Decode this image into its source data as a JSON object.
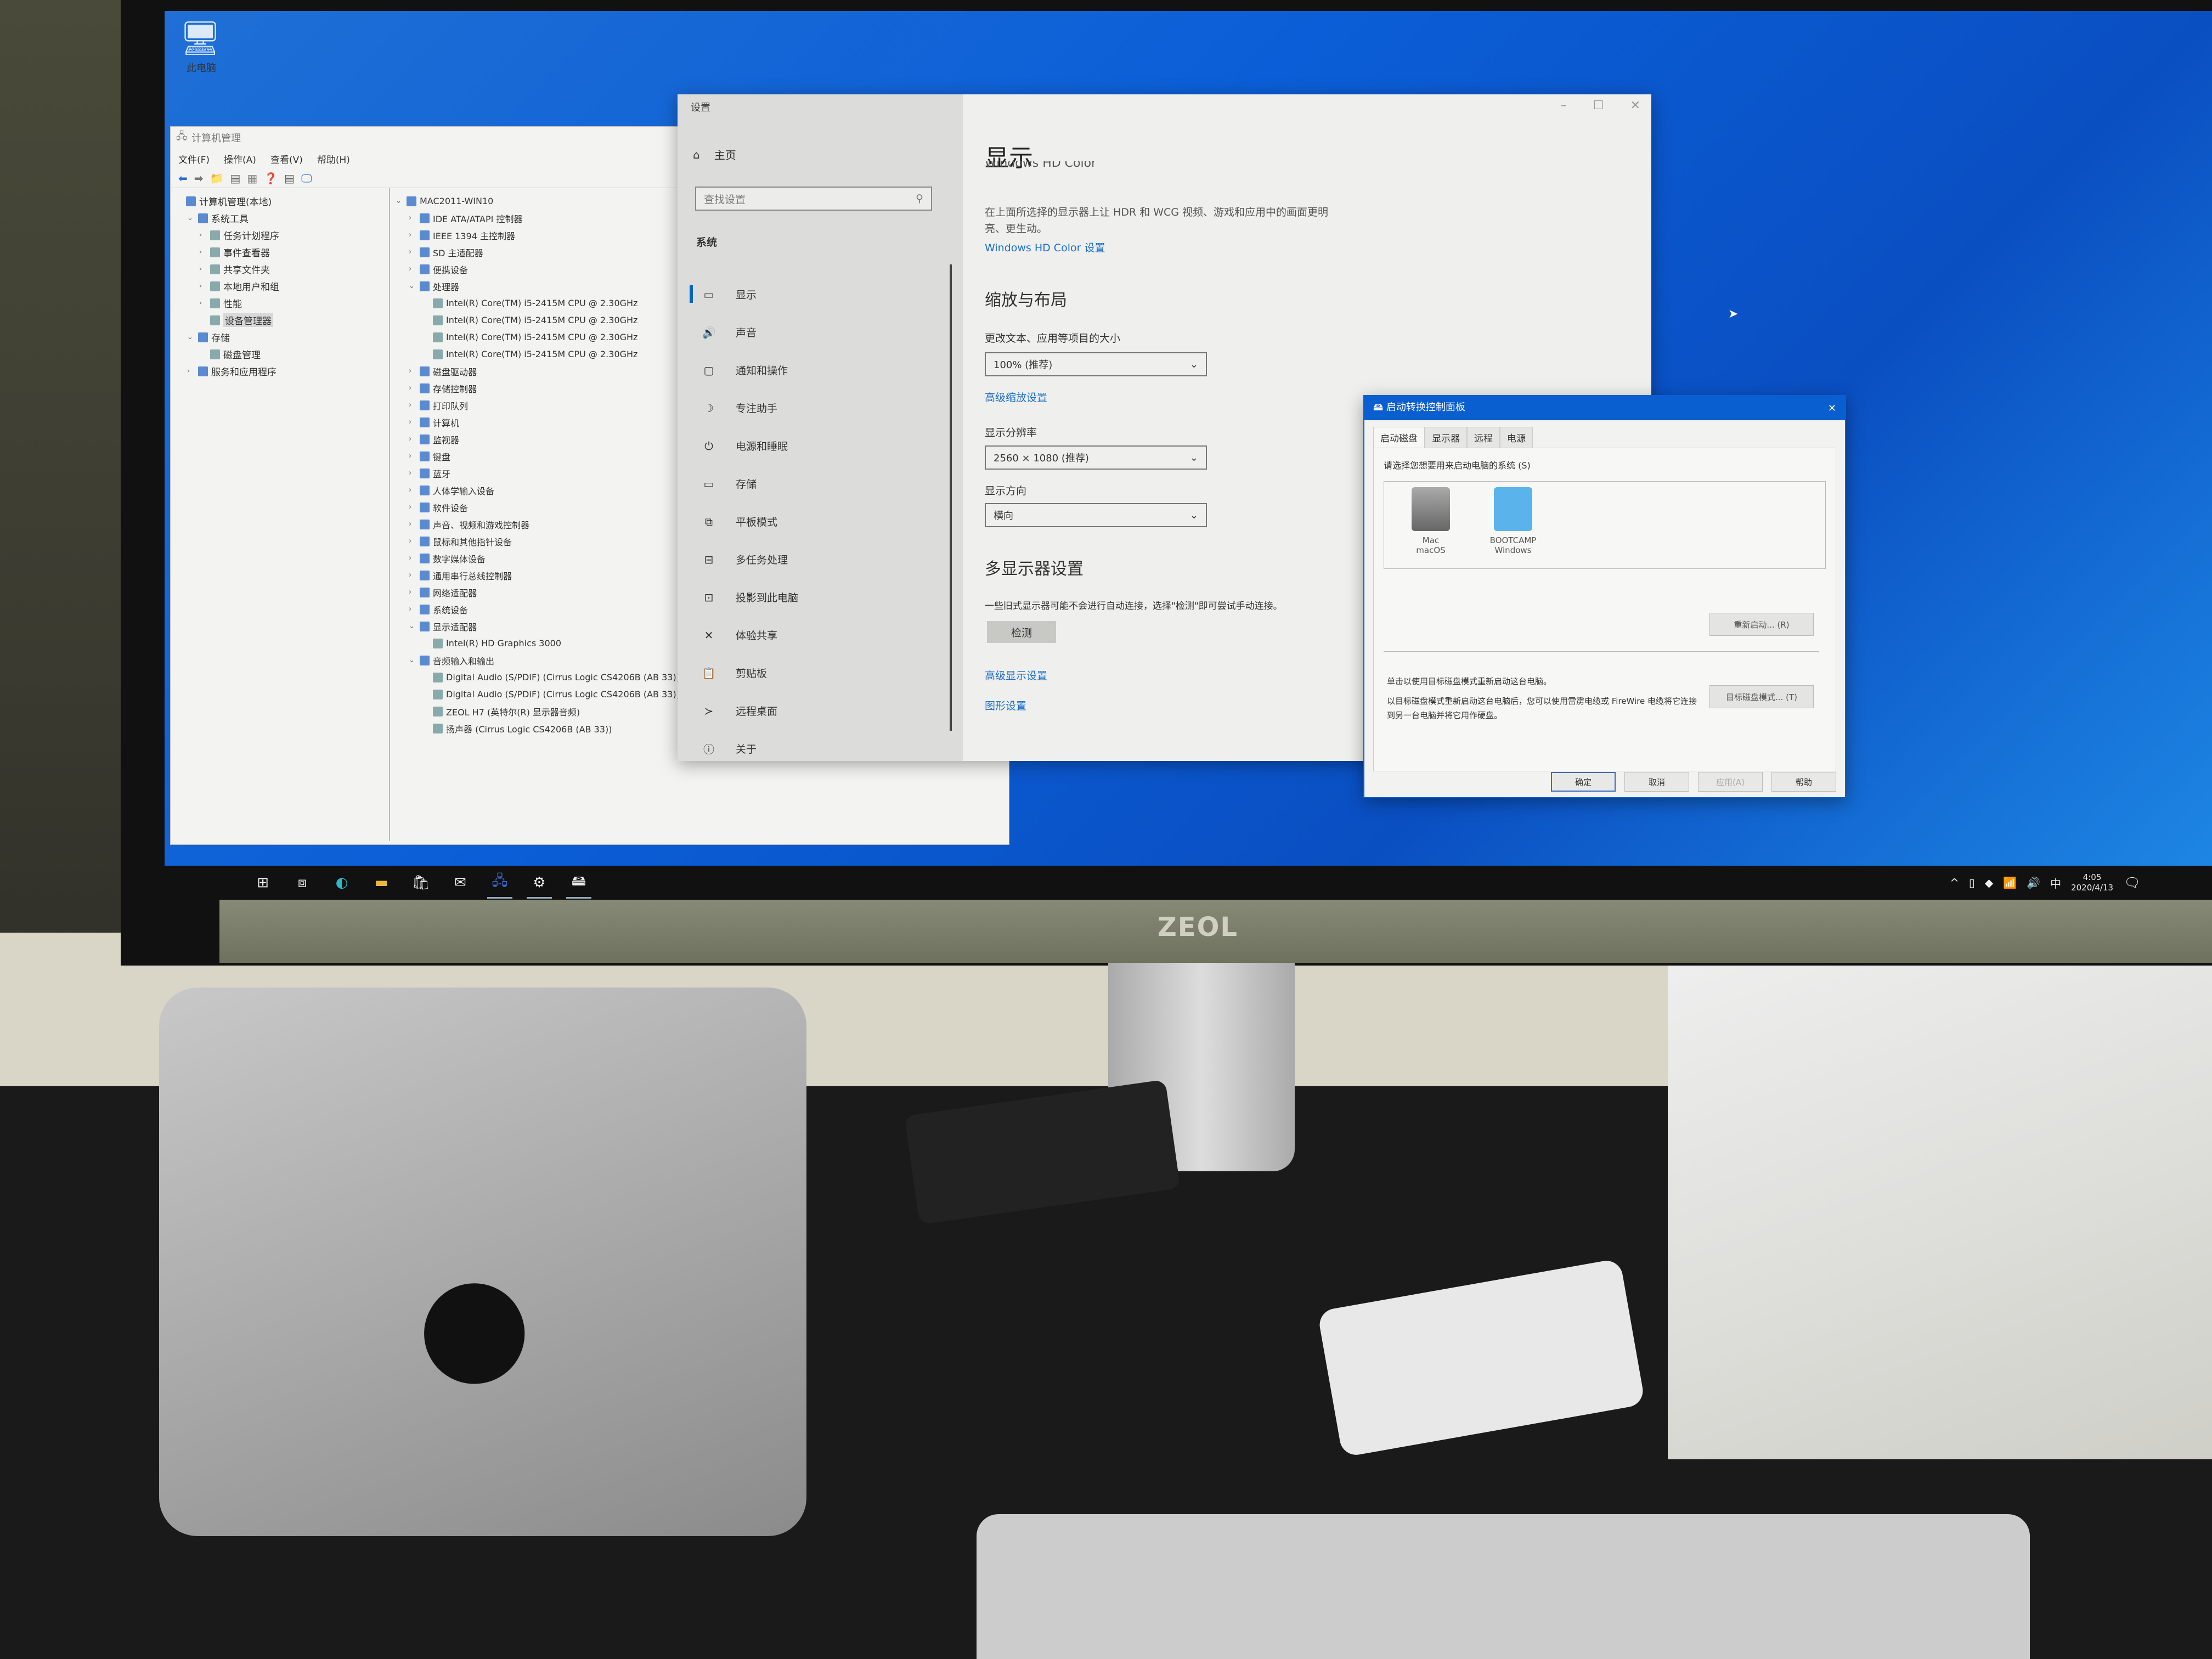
{
  "desktop": {
    "icon_label": "此电脑"
  },
  "computer_management": {
    "title": "计算机管理",
    "menu": [
      "文件(F)",
      "操作(A)",
      "查看(V)",
      "帮助(H)"
    ],
    "left_tree": [
      {
        "label": "计算机管理(本地)",
        "level": 0,
        "expand": ""
      },
      {
        "label": "系统工具",
        "level": 1,
        "expand": "v"
      },
      {
        "label": "任务计划程序",
        "level": 2,
        "expand": ">"
      },
      {
        "label": "事件查看器",
        "level": 2,
        "expand": ">"
      },
      {
        "label": "共享文件夹",
        "level": 2,
        "expand": ">"
      },
      {
        "label": "本地用户和组",
        "level": 2,
        "expand": ">"
      },
      {
        "label": "性能",
        "level": 2,
        "expand": ">"
      },
      {
        "label": "设备管理器",
        "level": 2,
        "expand": "",
        "selected": true
      },
      {
        "label": "存储",
        "level": 1,
        "expand": "v"
      },
      {
        "label": "磁盘管理",
        "level": 2,
        "expand": ""
      },
      {
        "label": "服务和应用程序",
        "level": 1,
        "expand": ">"
      }
    ],
    "device_tree": [
      {
        "label": "MAC2011-WIN10",
        "level": 0,
        "expand": "v"
      },
      {
        "label": "IDE ATA/ATAPI 控制器",
        "level": 1,
        "expand": ">"
      },
      {
        "label": "IEEE 1394 主控制器",
        "level": 1,
        "expand": ">"
      },
      {
        "label": "SD 主适配器",
        "level": 1,
        "expand": ">"
      },
      {
        "label": "便携设备",
        "level": 1,
        "expand": ">"
      },
      {
        "label": "处理器",
        "level": 1,
        "expand": "v"
      },
      {
        "label": "Intel(R) Core(TM) i5-2415M CPU @ 2.30GHz",
        "level": 2,
        "expand": ""
      },
      {
        "label": "Intel(R) Core(TM) i5-2415M CPU @ 2.30GHz",
        "level": 2,
        "expand": ""
      },
      {
        "label": "Intel(R) Core(TM) i5-2415M CPU @ 2.30GHz",
        "level": 2,
        "expand": ""
      },
      {
        "label": "Intel(R) Core(TM) i5-2415M CPU @ 2.30GHz",
        "level": 2,
        "expand": ""
      },
      {
        "label": "磁盘驱动器",
        "level": 1,
        "expand": ">"
      },
      {
        "label": "存储控制器",
        "level": 1,
        "expand": ">"
      },
      {
        "label": "打印队列",
        "level": 1,
        "expand": ">"
      },
      {
        "label": "计算机",
        "level": 1,
        "expand": ">"
      },
      {
        "label": "监视器",
        "level": 1,
        "expand": ">"
      },
      {
        "label": "键盘",
        "level": 1,
        "expand": ">"
      },
      {
        "label": "蓝牙",
        "level": 1,
        "expand": ">"
      },
      {
        "label": "人体学输入设备",
        "level": 1,
        "expand": ">"
      },
      {
        "label": "软件设备",
        "level": 1,
        "expand": ">"
      },
      {
        "label": "声音、视频和游戏控制器",
        "level": 1,
        "expand": ">"
      },
      {
        "label": "鼠标和其他指针设备",
        "level": 1,
        "expand": ">"
      },
      {
        "label": "数字媒体设备",
        "level": 1,
        "expand": ">"
      },
      {
        "label": "通用串行总线控制器",
        "level": 1,
        "expand": ">"
      },
      {
        "label": "网络适配器",
        "level": 1,
        "expand": ">"
      },
      {
        "label": "系统设备",
        "level": 1,
        "expand": ">"
      },
      {
        "label": "显示适配器",
        "level": 1,
        "expand": "v"
      },
      {
        "label": "Intel(R) HD Graphics 3000",
        "level": 2,
        "expand": ""
      },
      {
        "label": "音频输入和输出",
        "level": 1,
        "expand": "v"
      },
      {
        "label": "Digital Audio (S/PDIF) (Cirrus Logic CS4206B (AB 33))",
        "level": 2,
        "expand": ""
      },
      {
        "label": "Digital Audio (S/PDIF) (Cirrus Logic CS4206B (AB 33))",
        "level": 2,
        "expand": ""
      },
      {
        "label": "ZEOL H7 (英特尔(R) 显示器音频)",
        "level": 2,
        "expand": ""
      },
      {
        "label": "扬声器 (Cirrus Logic CS4206B (AB 33))",
        "level": 2,
        "expand": ""
      }
    ]
  },
  "settings": {
    "window_title": "设置",
    "home": "主页",
    "search_placeholder": "查找设置",
    "section": "系统",
    "nav": [
      {
        "label": "显示",
        "icon": "▭",
        "active": true
      },
      {
        "label": "声音",
        "icon": "🔊"
      },
      {
        "label": "通知和操作",
        "icon": "▢"
      },
      {
        "label": "专注助手",
        "icon": "☽"
      },
      {
        "label": "电源和睡眠",
        "icon": "⏻"
      },
      {
        "label": "存储",
        "icon": "▭"
      },
      {
        "label": "平板模式",
        "icon": "⧉"
      },
      {
        "label": "多任务处理",
        "icon": "⊟"
      },
      {
        "label": "投影到此电脑",
        "icon": "⊡"
      },
      {
        "label": "体验共享",
        "icon": "✕"
      },
      {
        "label": "剪贴板",
        "icon": "📋"
      },
      {
        "label": "远程桌面",
        "icon": "≻"
      },
      {
        "label": "关于",
        "icon": "ⓘ"
      }
    ],
    "page_title": "显示",
    "cut_heading": "Windows HD Color",
    "hdr_desc": "在上面所选择的显示器上让 HDR 和 WCG 视频、游戏和应用中的画面更明亮、更生动。",
    "hdr_link": "Windows HD Color 设置",
    "scale_heading": "缩放与布局",
    "scale_label": "更改文本、应用等项目的大小",
    "scale_value": "100% (推荐)",
    "advanced_scale_link": "高级缩放设置",
    "resolution_label": "显示分辨率",
    "resolution_value": "2560 × 1080 (推荐)",
    "orientation_label": "显示方向",
    "orientation_value": "横向",
    "multi_heading": "多显示器设置",
    "multi_desc": "一些旧式显示器可能不会进行自动连接，选择\"检测\"即可尝试手动连接。",
    "detect_button": "检测",
    "advanced_display_link": "高级显示设置",
    "graphics_link": "图形设置"
  },
  "bootcamp": {
    "title": "启动转换控制面板",
    "tabs": [
      "启动磁盘",
      "显示器",
      "远程",
      "电源"
    ],
    "prompt": "请选择您想要用来启动电脑的系统 (S)",
    "disks": [
      {
        "name": "Mac",
        "os": "macOS"
      },
      {
        "name": "BOOTCAMP",
        "os": "Windows"
      }
    ],
    "restart_button": "重新启动... (R)",
    "tdm_line1": "单击以使用目标磁盘模式重新启动这台电脑。",
    "tdm_line2": "以目标磁盘模式重新启动这台电脑后，您可以使用雷雳电缆或 FireWire 电缆将它连接到另一台电脑并将它用作硬盘。",
    "tdm_button": "目标磁盘模式... (T)",
    "ok": "确定",
    "cancel": "取消",
    "apply": "应用(A)",
    "help": "帮助"
  },
  "taskbar": {
    "time": "4:05",
    "date": "2020/4/13",
    "ime": "中"
  },
  "monitor_brand": "ZEOL"
}
